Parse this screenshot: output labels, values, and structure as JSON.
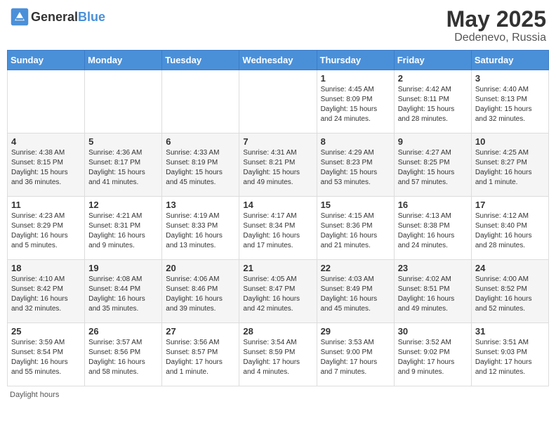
{
  "header": {
    "logo_general": "General",
    "logo_blue": "Blue",
    "title": "May 2025",
    "subtitle": "Dedenevo, Russia"
  },
  "days_of_week": [
    "Sunday",
    "Monday",
    "Tuesday",
    "Wednesday",
    "Thursday",
    "Friday",
    "Saturday"
  ],
  "weeks": [
    [
      {
        "num": "",
        "info": ""
      },
      {
        "num": "",
        "info": ""
      },
      {
        "num": "",
        "info": ""
      },
      {
        "num": "",
        "info": ""
      },
      {
        "num": "1",
        "info": "Sunrise: 4:45 AM\nSunset: 8:09 PM\nDaylight: 15 hours and 24 minutes."
      },
      {
        "num": "2",
        "info": "Sunrise: 4:42 AM\nSunset: 8:11 PM\nDaylight: 15 hours and 28 minutes."
      },
      {
        "num": "3",
        "info": "Sunrise: 4:40 AM\nSunset: 8:13 PM\nDaylight: 15 hours and 32 minutes."
      }
    ],
    [
      {
        "num": "4",
        "info": "Sunrise: 4:38 AM\nSunset: 8:15 PM\nDaylight: 15 hours and 36 minutes."
      },
      {
        "num": "5",
        "info": "Sunrise: 4:36 AM\nSunset: 8:17 PM\nDaylight: 15 hours and 41 minutes."
      },
      {
        "num": "6",
        "info": "Sunrise: 4:33 AM\nSunset: 8:19 PM\nDaylight: 15 hours and 45 minutes."
      },
      {
        "num": "7",
        "info": "Sunrise: 4:31 AM\nSunset: 8:21 PM\nDaylight: 15 hours and 49 minutes."
      },
      {
        "num": "8",
        "info": "Sunrise: 4:29 AM\nSunset: 8:23 PM\nDaylight: 15 hours and 53 minutes."
      },
      {
        "num": "9",
        "info": "Sunrise: 4:27 AM\nSunset: 8:25 PM\nDaylight: 15 hours and 57 minutes."
      },
      {
        "num": "10",
        "info": "Sunrise: 4:25 AM\nSunset: 8:27 PM\nDaylight: 16 hours and 1 minute."
      }
    ],
    [
      {
        "num": "11",
        "info": "Sunrise: 4:23 AM\nSunset: 8:29 PM\nDaylight: 16 hours and 5 minutes."
      },
      {
        "num": "12",
        "info": "Sunrise: 4:21 AM\nSunset: 8:31 PM\nDaylight: 16 hours and 9 minutes."
      },
      {
        "num": "13",
        "info": "Sunrise: 4:19 AM\nSunset: 8:33 PM\nDaylight: 16 hours and 13 minutes."
      },
      {
        "num": "14",
        "info": "Sunrise: 4:17 AM\nSunset: 8:34 PM\nDaylight: 16 hours and 17 minutes."
      },
      {
        "num": "15",
        "info": "Sunrise: 4:15 AM\nSunset: 8:36 PM\nDaylight: 16 hours and 21 minutes."
      },
      {
        "num": "16",
        "info": "Sunrise: 4:13 AM\nSunset: 8:38 PM\nDaylight: 16 hours and 24 minutes."
      },
      {
        "num": "17",
        "info": "Sunrise: 4:12 AM\nSunset: 8:40 PM\nDaylight: 16 hours and 28 minutes."
      }
    ],
    [
      {
        "num": "18",
        "info": "Sunrise: 4:10 AM\nSunset: 8:42 PM\nDaylight: 16 hours and 32 minutes."
      },
      {
        "num": "19",
        "info": "Sunrise: 4:08 AM\nSunset: 8:44 PM\nDaylight: 16 hours and 35 minutes."
      },
      {
        "num": "20",
        "info": "Sunrise: 4:06 AM\nSunset: 8:46 PM\nDaylight: 16 hours and 39 minutes."
      },
      {
        "num": "21",
        "info": "Sunrise: 4:05 AM\nSunset: 8:47 PM\nDaylight: 16 hours and 42 minutes."
      },
      {
        "num": "22",
        "info": "Sunrise: 4:03 AM\nSunset: 8:49 PM\nDaylight: 16 hours and 45 minutes."
      },
      {
        "num": "23",
        "info": "Sunrise: 4:02 AM\nSunset: 8:51 PM\nDaylight: 16 hours and 49 minutes."
      },
      {
        "num": "24",
        "info": "Sunrise: 4:00 AM\nSunset: 8:52 PM\nDaylight: 16 hours and 52 minutes."
      }
    ],
    [
      {
        "num": "25",
        "info": "Sunrise: 3:59 AM\nSunset: 8:54 PM\nDaylight: 16 hours and 55 minutes."
      },
      {
        "num": "26",
        "info": "Sunrise: 3:57 AM\nSunset: 8:56 PM\nDaylight: 16 hours and 58 minutes."
      },
      {
        "num": "27",
        "info": "Sunrise: 3:56 AM\nSunset: 8:57 PM\nDaylight: 17 hours and 1 minute."
      },
      {
        "num": "28",
        "info": "Sunrise: 3:54 AM\nSunset: 8:59 PM\nDaylight: 17 hours and 4 minutes."
      },
      {
        "num": "29",
        "info": "Sunrise: 3:53 AM\nSunset: 9:00 PM\nDaylight: 17 hours and 7 minutes."
      },
      {
        "num": "30",
        "info": "Sunrise: 3:52 AM\nSunset: 9:02 PM\nDaylight: 17 hours and 9 minutes."
      },
      {
        "num": "31",
        "info": "Sunrise: 3:51 AM\nSunset: 9:03 PM\nDaylight: 17 hours and 12 minutes."
      }
    ]
  ],
  "footer": {
    "note": "Daylight hours"
  }
}
